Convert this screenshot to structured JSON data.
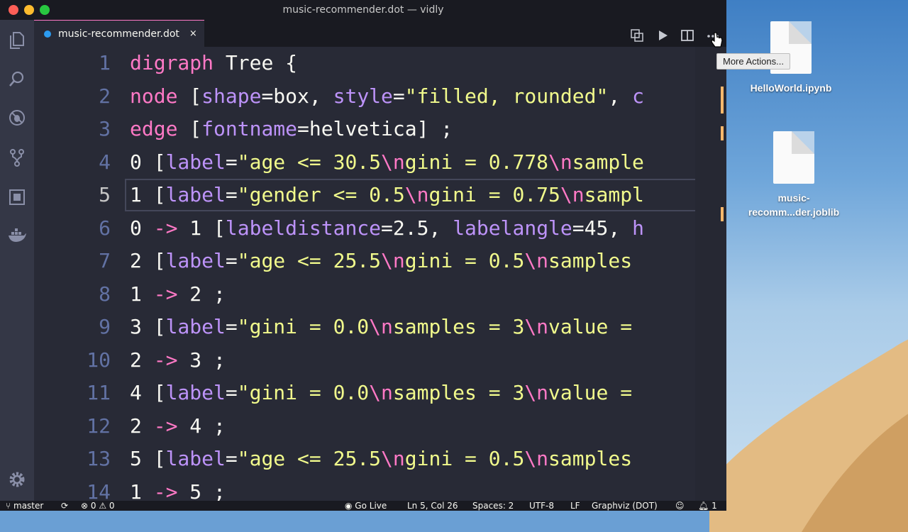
{
  "window": {
    "title": "music-recommender.dot — vidly"
  },
  "tab": {
    "title": "music-recommender.dot",
    "close": "×"
  },
  "tooltip": "More Actions...",
  "editor": {
    "lines": [
      {
        "num": "1",
        "html": "<span class=\"kw\">digraph</span> Tree {"
      },
      {
        "num": "2",
        "html": "<span class=\"kw\">node</span> [<span class=\"at\">shape</span>=box, <span class=\"at\">style</span>=<span class=\"st\">\"filled, rounded\"</span>, <span class=\"at\">c</span>"
      },
      {
        "num": "3",
        "html": "<span class=\"kw\">edge</span> [<span class=\"at\">fontname</span>=helvetica] ;"
      },
      {
        "num": "4",
        "html": "0 [<span class=\"at\">label</span>=<span class=\"st\">\"age &lt;= 30.5</span><span class=\"es\">\\n</span><span class=\"st\">gini = 0.778</span><span class=\"es\">\\n</span><span class=\"st\">sample</span>"
      },
      {
        "num": "5",
        "html": "1 [<span class=\"at\">label</span>=<span class=\"st\">\"gender &lt;= 0.5</span><span class=\"es\">\\n</span><span class=\"st\">gini = 0.75</span><span class=\"es\">\\n</span><span class=\"st\">sampl</span>"
      },
      {
        "num": "6",
        "html": "0 <span class=\"kw\">-&gt;</span> 1 [<span class=\"at\">labeldistance</span>=2.5, <span class=\"at\">labelangle</span>=45, <span class=\"at\">h</span>"
      },
      {
        "num": "7",
        "html": "2 [<span class=\"at\">label</span>=<span class=\"st\">\"age &lt;= 25.5</span><span class=\"es\">\\n</span><span class=\"st\">gini = 0.5</span><span class=\"es\">\\n</span><span class=\"st\">samples</span>"
      },
      {
        "num": "8",
        "html": "1 <span class=\"kw\">-&gt;</span> 2 ;"
      },
      {
        "num": "9",
        "html": "3 [<span class=\"at\">label</span>=<span class=\"st\">\"gini = 0.0</span><span class=\"es\">\\n</span><span class=\"st\">samples = 3</span><span class=\"es\">\\n</span><span class=\"st\">value = </span>"
      },
      {
        "num": "10",
        "html": "2 <span class=\"kw\">-&gt;</span> 3 ;"
      },
      {
        "num": "11",
        "html": "4 [<span class=\"at\">label</span>=<span class=\"st\">\"gini = 0.0</span><span class=\"es\">\\n</span><span class=\"st\">samples = 3</span><span class=\"es\">\\n</span><span class=\"st\">value = </span>"
      },
      {
        "num": "12",
        "html": "2 <span class=\"kw\">-&gt;</span> 4 ;"
      },
      {
        "num": "13",
        "html": "5 [<span class=\"at\">label</span>=<span class=\"st\">\"age &lt;= 25.5</span><span class=\"es\">\\n</span><span class=\"st\">gini = 0.5</span><span class=\"es\">\\n</span><span class=\"st\">samples</span>"
      },
      {
        "num": "14",
        "html": "1 <span class=\"kw\">-&gt;</span> 5 ;"
      }
    ]
  },
  "statusbar": {
    "branch": "master",
    "problems": "0",
    "warnings": "0",
    "golive": "Go Live",
    "position": "Ln 5, Col 26",
    "spaces": "Spaces: 2",
    "encoding": "UTF-8",
    "eol": "LF",
    "language": "Graphviz (DOT)",
    "notifications": "1"
  },
  "desktop": {
    "icons": [
      {
        "label": "HelloWorld.ipynb"
      },
      {
        "label": "music-\nrecomm...der.joblib"
      }
    ]
  }
}
